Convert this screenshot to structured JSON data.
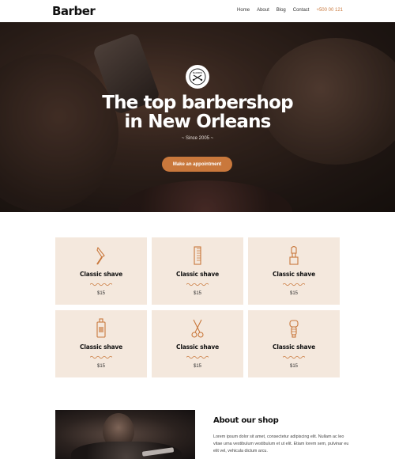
{
  "header": {
    "logo": "Barber",
    "nav": [
      {
        "label": "Home"
      },
      {
        "label": "About"
      },
      {
        "label": "Blog"
      },
      {
        "label": "Contact"
      }
    ],
    "phone": "+500 00 121"
  },
  "hero": {
    "badge_text": "BARBER",
    "title_line1": "The top barbershop",
    "title_line2": "in New Orleans",
    "since": "~ Since 2005 ~",
    "cta_label": "Make an appointment"
  },
  "services": [
    {
      "name": "Classic shave",
      "price": "$15",
      "icon": "razor-icon"
    },
    {
      "name": "Classic shave",
      "price": "$15",
      "icon": "comb-icon"
    },
    {
      "name": "Classic shave",
      "price": "$15",
      "icon": "shaving-brush-icon"
    },
    {
      "name": "Classic shave",
      "price": "$15",
      "icon": "bottle-icon"
    },
    {
      "name": "Classic shave",
      "price": "$15",
      "icon": "scissors-icon"
    },
    {
      "name": "Classic shave",
      "price": "$15",
      "icon": "razor-blade-icon"
    }
  ],
  "about": {
    "title": "About our shop",
    "text": "Lorem ipsum dolor sit amet, consectetur adipiscing elit. Nullam ac leo vitae urna vestibulum vestibulum et ut elit. Etiam lorem sem, pulvinar eu elit vel, vehicula dictum arcu."
  },
  "colors": {
    "accent": "#c9783c",
    "card_bg": "#f4e8dd"
  }
}
